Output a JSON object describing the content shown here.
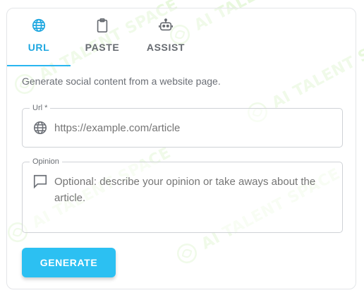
{
  "watermark": {
    "text": "AI TALENT SPACE",
    "color": "#9be36a"
  },
  "tabs": [
    {
      "label": "URL",
      "icon": "globe-icon",
      "active": true
    },
    {
      "label": "PASTE",
      "icon": "clipboard-icon",
      "active": false
    },
    {
      "label": "ASSIST",
      "icon": "robot-icon",
      "active": false
    }
  ],
  "description": "Generate social content from a website page.",
  "url_field": {
    "label": "Url *",
    "placeholder": "https://example.com/article",
    "value": "",
    "icon": "globe-icon"
  },
  "opinion_field": {
    "label": "Opinion",
    "placeholder": "Optional: describe your opinion or take aways about the article.",
    "value": "",
    "icon": "comment-icon"
  },
  "generate_button": {
    "label": "GENERATE"
  },
  "colors": {
    "accent": "#29b6f0",
    "button": "#2cc0f2",
    "border": "#cfd2d6",
    "text_muted": "#6b6f76"
  }
}
